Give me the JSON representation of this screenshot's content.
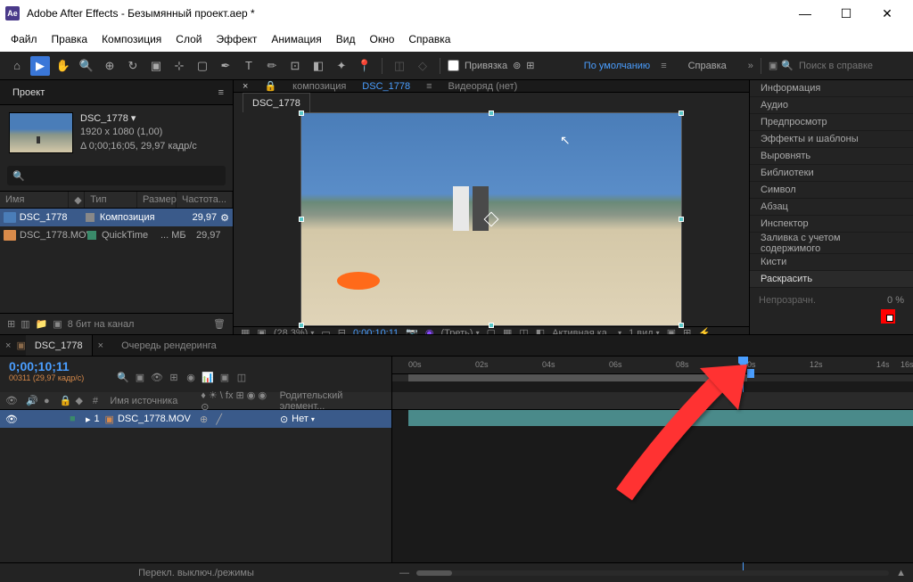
{
  "title": "Adobe After Effects - Безымянный проект.aep *",
  "logo": "Ae",
  "menu": [
    "Файл",
    "Правка",
    "Композиция",
    "Слой",
    "Эффект",
    "Анимация",
    "Вид",
    "Окно",
    "Справка"
  ],
  "toolbar": {
    "snap": "Привязка",
    "mode": "По умолчанию",
    "help": "Справка",
    "search_ph": "Поиск в справке"
  },
  "project": {
    "panel": "Проект",
    "name": "DSC_1778",
    "dims": "1920 x 1080 (1,00)",
    "dur": "Δ 0;00;16;05, 29,97 кадр/с",
    "cols": {
      "name": "Имя",
      "type": "Тип",
      "size": "Размер",
      "freq": "Частота..."
    },
    "rows": [
      {
        "name": "DSC_1778",
        "type": "Композиция",
        "size": "",
        "freq": "29,97"
      },
      {
        "name": "DSC_1778.MOV",
        "type": "QuickTime",
        "size": "... МБ",
        "freq": "29,97"
      }
    ],
    "bpc": "8 бит на канал"
  },
  "comp": {
    "label": "композиция",
    "name": "DSC_1778",
    "vr": "Видеоряд (нет)",
    "tab": "DSC_1778",
    "zoom": "(28,3%)",
    "tc": "0;00;10;11",
    "res": "(Треть)",
    "cam": "Активная ка...",
    "views": "1 вид"
  },
  "right": {
    "items": [
      "Информация",
      "Аудио",
      "Предпросмотр",
      "Эффекты и шаблоны",
      "Выровнять",
      "Библиотеки",
      "Символ",
      "Абзац",
      "Инспектор",
      "Заливка с учетом содержимого",
      "Кисти",
      "Раскрасить"
    ],
    "opacity": "Непрозрачн.",
    "opv": "0 %"
  },
  "tl": {
    "tab": "DSC_1778",
    "rq": "Очередь рендеринга",
    "tc": "0;00;10;11",
    "fr": "00311 (29,97 кадр/с)",
    "hdr": {
      "num": "#",
      "src": "Имя источника",
      "mode": "♦ ☀ \\ fx ⊞ ◉ ◉ ⊙",
      "parent": "Родительский элемент..."
    },
    "row": {
      "n": "1",
      "name": "DSC_1778.MOV",
      "parent": "Нет"
    },
    "ticks": [
      "00s",
      "02s",
      "04s",
      "06s",
      "08s",
      "10s",
      "12s",
      "14s",
      "16s"
    ],
    "toggle": "Перекл. выключ./режимы"
  }
}
